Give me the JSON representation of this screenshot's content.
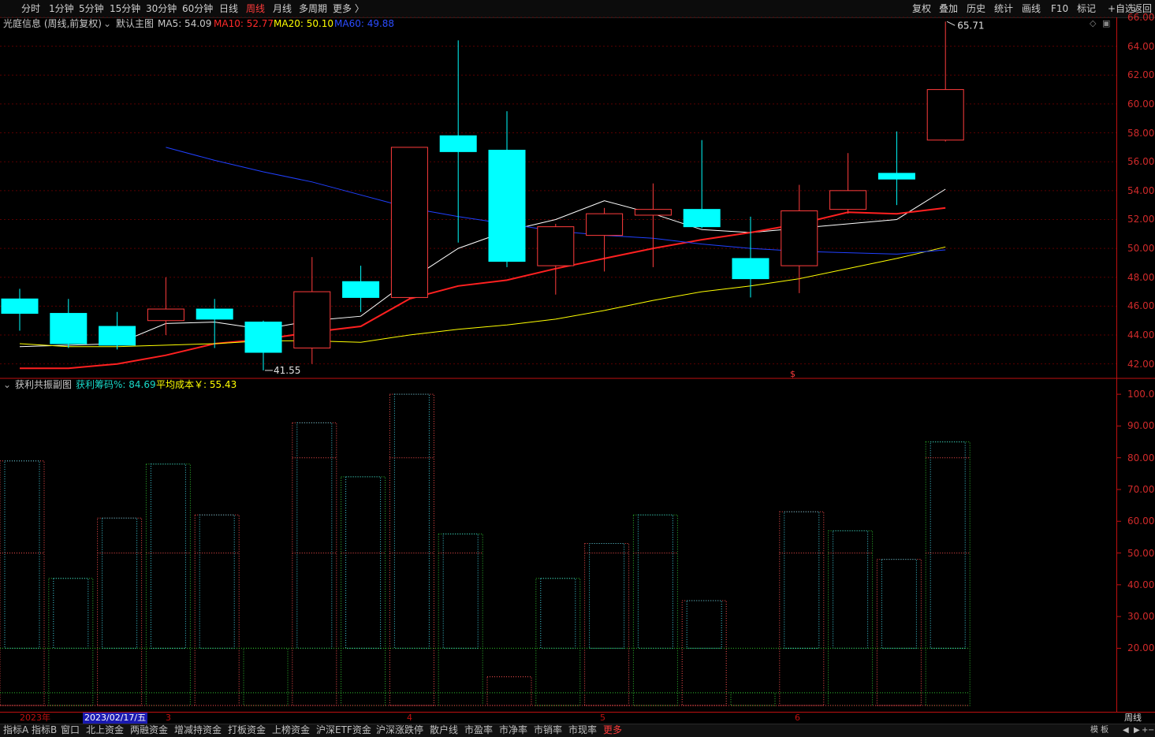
{
  "periods": [
    "分时",
    "1分钟",
    "5分钟",
    "15分钟",
    "30分钟",
    "60分钟",
    "日线",
    "周线",
    "月线",
    "多周期",
    "更多 〉"
  ],
  "active_period": "周线",
  "right_tools": [
    "复权",
    "叠加",
    "历史",
    "统计",
    "画线",
    "F10",
    "标记",
    "+自选",
    "返回"
  ],
  "main_chart": {
    "stock": "光庭信息 (周线,前复权)",
    "template": "默认主图",
    "ma": [
      {
        "label": "MA5: 54.09",
        "color": "#ffffff"
      },
      {
        "label": "MA10: 52.77",
        "color": "#ff2020"
      },
      {
        "label": "MA20: 50.10",
        "color": "#ffff00"
      },
      {
        "label": "MA60: 49.88",
        "color": "#2040ff"
      }
    ],
    "high_label": "65.71",
    "low_label": "41.55",
    "axis_labels": [
      "66.00",
      "64.00",
      "62.00",
      "60.00",
      "58.00",
      "56.00",
      "54.00",
      "52.00",
      "50.00",
      "48.00",
      "46.00",
      "44.00",
      "42.00"
    ]
  },
  "sub_chart": {
    "title": "获利共振副图",
    "value1": "获利筹码%: 84.69",
    "value2": "平均成本￥: 55.43",
    "axis_labels": [
      "100.0",
      "90.00",
      "80.00",
      "70.00",
      "60.00",
      "50.00",
      "40.00",
      "30.00",
      "20.00"
    ]
  },
  "chart_data": [
    {
      "type": "candlestick",
      "title": "光庭信息 (周线,前复权)",
      "ylim": [
        41,
        66
      ],
      "candles": [
        {
          "o": 46.5,
          "c": 45.5,
          "h": 47.2,
          "l": 44.3
        },
        {
          "o": 45.5,
          "c": 43.4,
          "h": 46.5,
          "l": 43.1
        },
        {
          "o": 44.6,
          "c": 43.3,
          "h": 45.6,
          "l": 43.0
        },
        {
          "o": 45.0,
          "c": 45.8,
          "h": 48.0,
          "l": 44.0
        },
        {
          "o": 45.8,
          "c": 45.1,
          "h": 46.5,
          "l": 43.1
        },
        {
          "o": 44.9,
          "c": 42.8,
          "h": 45.0,
          "l": 41.55
        },
        {
          "o": 43.1,
          "c": 47.0,
          "h": 49.4,
          "l": 42.0
        },
        {
          "o": 47.7,
          "c": 46.6,
          "h": 48.8,
          "l": 45.6
        },
        {
          "o": 46.6,
          "c": 57.0,
          "h": 57.0,
          "l": 46.5
        },
        {
          "o": 57.8,
          "c": 56.7,
          "h": 64.4,
          "l": 50.4
        },
        {
          "o": 56.8,
          "c": 49.1,
          "h": 59.5,
          "l": 48.7
        },
        {
          "o": 48.8,
          "c": 51.5,
          "h": 51.7,
          "l": 46.8
        },
        {
          "o": 50.9,
          "c": 52.4,
          "h": 52.8,
          "l": 48.4
        },
        {
          "o": 52.3,
          "c": 52.7,
          "h": 54.5,
          "l": 48.7
        },
        {
          "o": 52.7,
          "c": 51.5,
          "h": 57.5,
          "l": 51.4
        },
        {
          "o": 49.3,
          "c": 47.9,
          "h": 52.2,
          "l": 46.6
        },
        {
          "o": 48.8,
          "c": 52.6,
          "h": 54.4,
          "l": 46.9
        },
        {
          "o": 52.7,
          "c": 54.0,
          "h": 56.6,
          "l": 52.4
        },
        {
          "o": 55.2,
          "c": 54.8,
          "h": 58.1,
          "l": 53.0
        },
        {
          "o": 57.5,
          "c": 61.0,
          "h": 65.71,
          "l": 57.4
        }
      ],
      "series": [
        {
          "name": "MA5",
          "values": [
            43.2,
            43.3,
            43.4,
            44.8,
            44.9,
            44.4,
            45.0,
            45.3,
            47.8,
            50.0,
            51.2,
            52.0,
            53.3,
            52.4,
            51.3,
            51.1,
            51.4,
            51.7,
            52.0,
            54.1
          ]
        },
        {
          "name": "MA10",
          "values": [
            41.7,
            41.7,
            42.0,
            42.6,
            43.4,
            43.7,
            44.2,
            44.6,
            46.5,
            47.4,
            47.8,
            48.6,
            49.3,
            50.0,
            50.6,
            51.1,
            51.7,
            52.5,
            52.4,
            52.8
          ]
        },
        {
          "name": "MA20",
          "values": [
            43.4,
            43.2,
            43.2,
            43.3,
            43.4,
            43.6,
            43.6,
            43.5,
            44.0,
            44.4,
            44.7,
            45.1,
            45.7,
            46.4,
            47.0,
            47.4,
            47.9,
            48.6,
            49.3,
            50.1
          ]
        },
        {
          "name": "MA60",
          "values": [
            null,
            null,
            null,
            57.0,
            56.1,
            55.3,
            54.6,
            53.7,
            52.8,
            52.2,
            51.7,
            51.2,
            50.9,
            50.7,
            50.3,
            50.0,
            49.8,
            49.7,
            49.6,
            49.9
          ]
        }
      ]
    },
    {
      "type": "bar",
      "title": "获利共振副图",
      "ylim": [
        0,
        100
      ],
      "series": [
        {
          "name": "获利筹码%",
          "values": [
            79,
            42,
            61,
            78,
            62,
            20,
            91,
            74,
            100,
            56,
            11,
            42,
            53,
            62,
            35,
            6,
            63,
            57,
            48,
            85
          ]
        }
      ]
    }
  ],
  "date_labels": [
    "2023年",
    "2023/02/17/五",
    "3",
    "4",
    "5",
    "6"
  ],
  "period_label": "周线",
  "bottom_tabs": [
    "指标A",
    "指标B",
    "窗口",
    "北上资金",
    "两融资金",
    "增减持资金",
    "打板资金",
    "上榜资金",
    "沪深ETF资金",
    "沪深涨跌停",
    "散户线",
    "市盈率",
    "市净率",
    "市销率",
    "市现率",
    "更多"
  ],
  "bottom_right": [
    "模 板",
    "◀",
    "▶",
    "+",
    "−"
  ]
}
